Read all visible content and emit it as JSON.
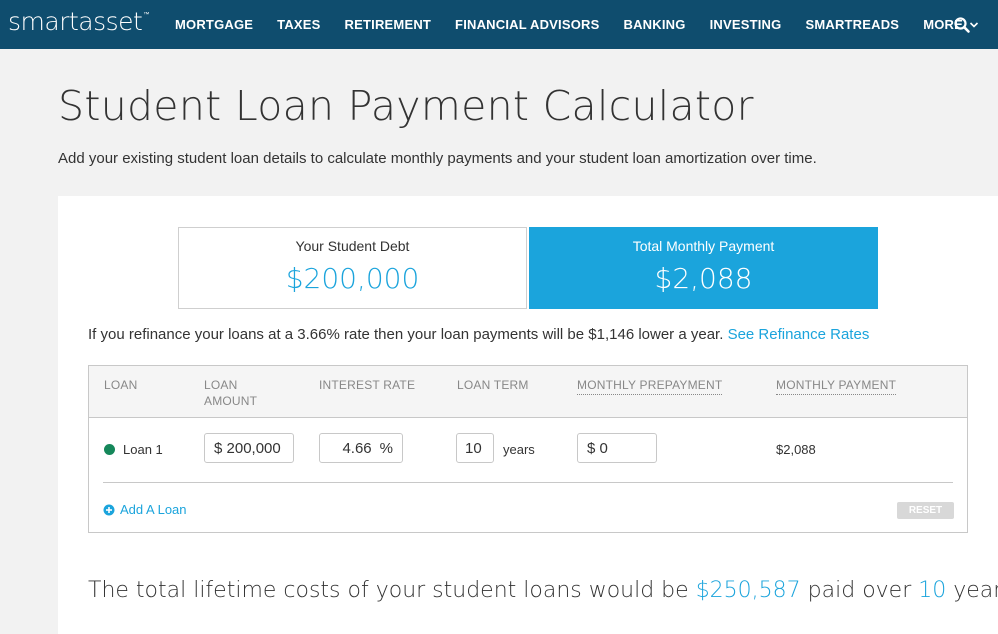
{
  "nav": {
    "logo": "smartasset",
    "logo_tm": "™",
    "items": [
      "MORTGAGE",
      "TAXES",
      "RETIREMENT",
      "FINANCIAL ADVISORS",
      "BANKING",
      "INVESTING",
      "SMARTREADS",
      "MORE"
    ],
    "search_icon": "search-icon"
  },
  "header": {
    "title": "Student Loan Payment Calculator",
    "subtitle": "Add your existing student loan details to calculate monthly payments and your student loan amortization over time."
  },
  "summary": {
    "debt_label": "Your Student Debt",
    "debt_value": "$200,000",
    "payment_label": "Total Monthly Payment",
    "payment_value": "$2,088"
  },
  "refinance": {
    "text": "If you refinance your loans at a 3.66% rate then your loan payments will be $1,146 lower a year.",
    "link": "See Refinance Rates"
  },
  "table": {
    "headers": {
      "loan": "LOAN",
      "loan_amount_1": "LOAN",
      "loan_amount_2": "AMOUNT",
      "interest_rate": "INTEREST RATE",
      "loan_term": "LOAN TERM",
      "monthly_prepayment": "MONTHLY PREPAYMENT",
      "monthly_payment": "MONTHLY PAYMENT"
    },
    "rows": [
      {
        "name": "Loan 1",
        "amount": "$ 200,000",
        "rate": "4.66",
        "rate_unit": "%",
        "term": "10",
        "term_unit": "years",
        "prepayment": "$ 0",
        "monthly": "$2,088"
      }
    ],
    "add_loan": "Add A Loan",
    "reset": "RESET"
  },
  "lifetime": {
    "prefix": "The total lifetime costs of your student loans would be",
    "total": "$250,587",
    "middle": "paid over",
    "years": "10",
    "suffix": "years."
  },
  "colors": {
    "nav_bg": "#0f4d6e",
    "accent": "#1ba4dc",
    "loan_dot": "#15875a"
  }
}
